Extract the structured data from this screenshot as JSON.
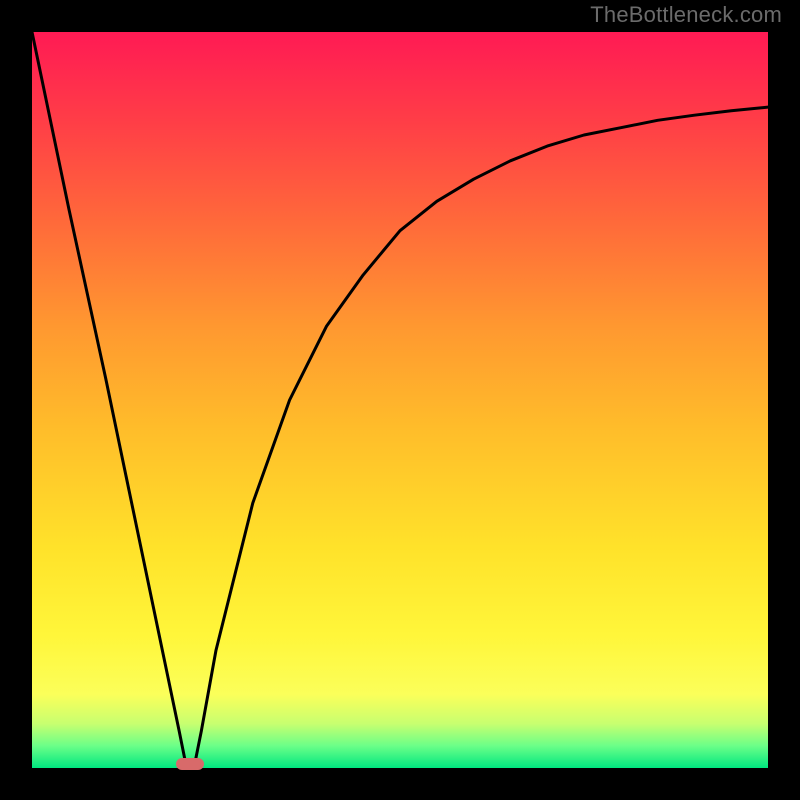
{
  "watermark": "TheBottleneck.com",
  "colors": {
    "frame": "#000000",
    "watermark": "#6b6b6b",
    "curve": "#000000",
    "marker": "#d86a6a",
    "gradient_stops_top_to_bottom": [
      "#ff1a54",
      "#ff3d47",
      "#ff6a3a",
      "#ff9830",
      "#ffbd2a",
      "#ffe22a",
      "#fff63a",
      "#fbff5a",
      "#c7ff70",
      "#6bff88",
      "#00e780"
    ]
  },
  "chart_data": {
    "type": "line",
    "title": "",
    "xlabel": "",
    "ylabel": "",
    "xlim": [
      0,
      100
    ],
    "ylim": [
      0,
      100
    ],
    "series": [
      {
        "name": "bottleneck-curve",
        "x": [
          0,
          5,
          10,
          15,
          20,
          21,
          22,
          23,
          25,
          30,
          35,
          40,
          45,
          50,
          55,
          60,
          65,
          70,
          75,
          80,
          85,
          90,
          95,
          100
        ],
        "values": [
          100,
          76,
          53,
          29,
          5,
          0,
          0,
          5,
          16,
          36,
          50,
          60,
          67,
          73,
          77,
          80,
          82.5,
          84.5,
          86,
          87,
          88,
          88.7,
          89.3,
          89.8
        ]
      }
    ],
    "annotations": [
      {
        "name": "minimum-marker",
        "x": 21.5,
        "y": 0
      }
    ],
    "legend": false,
    "grid": false
  }
}
